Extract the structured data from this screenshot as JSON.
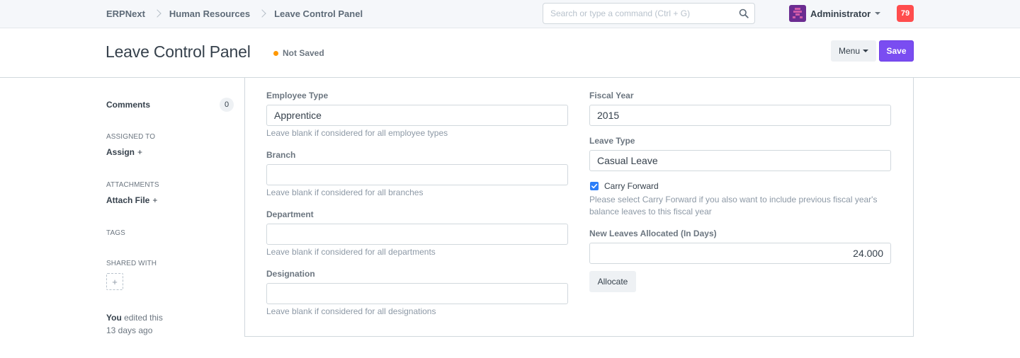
{
  "navbar": {
    "breadcrumbs": [
      "ERPNext",
      "Human Resources",
      "Leave Control Panel"
    ],
    "search_placeholder": "Search or type a command (Ctrl + G)",
    "user_name": "Administrator",
    "notification_count": "79"
  },
  "page": {
    "title": "Leave Control Panel",
    "status": "Not Saved",
    "menu_label": "Menu",
    "save_label": "Save"
  },
  "sidebar": {
    "comments_label": "Comments",
    "comments_count": "0",
    "assigned_heading": "ASSIGNED TO",
    "assign_label": "Assign",
    "attachments_heading": "ATTACHMENTS",
    "attach_label": "Attach File",
    "tags_heading": "TAGS",
    "shared_heading": "SHARED WITH",
    "plus": "+",
    "edited_by": "You",
    "edited_text": " edited this",
    "edited_when": "13 days ago"
  },
  "form": {
    "employee_type": {
      "label": "Employee Type",
      "value": "Apprentice",
      "help": "Leave blank if considered for all employee types"
    },
    "branch": {
      "label": "Branch",
      "value": "",
      "help": "Leave blank if considered for all branches"
    },
    "department": {
      "label": "Department",
      "value": "",
      "help": "Leave blank if considered for all departments"
    },
    "designation": {
      "label": "Designation",
      "value": "",
      "help": "Leave blank if considered for all designations"
    },
    "fiscal_year": {
      "label": "Fiscal Year",
      "value": "2015"
    },
    "leave_type": {
      "label": "Leave Type",
      "value": "Casual Leave"
    },
    "carry_forward": {
      "label": "Carry Forward",
      "checked": true,
      "help": "Please select Carry Forward if you also want to include previous fiscal year's balance leaves to this fiscal year"
    },
    "new_leaves": {
      "label": "New Leaves Allocated (In Days)",
      "value": "24.000"
    },
    "allocate_label": "Allocate"
  },
  "colors": {
    "primary": "#7a4df1",
    "indicator_orange": "#ff9800",
    "notification_red": "#ff4d4d",
    "checkbox_blue": "#2c7ef8"
  }
}
